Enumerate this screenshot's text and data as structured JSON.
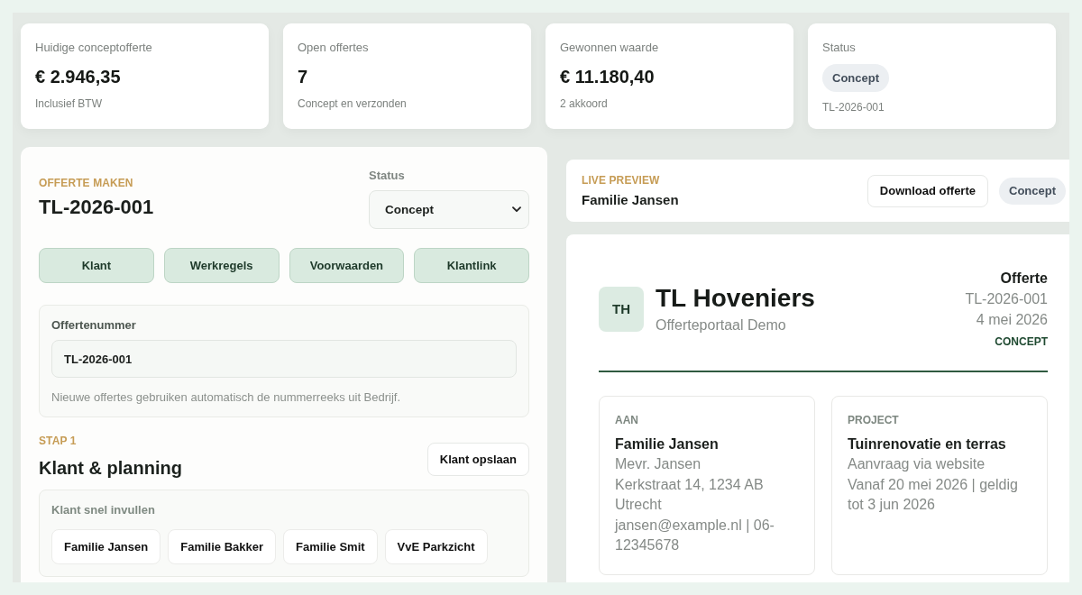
{
  "stats": [
    {
      "kind": "value",
      "label": "Huidige conceptofferte",
      "value": "€ 2.946,35",
      "note": "Inclusief BTW"
    },
    {
      "kind": "value",
      "label": "Open offertes",
      "value": "7",
      "note": "Concept en verzonden"
    },
    {
      "kind": "value",
      "label": "Gewonnen waarde",
      "value": "€ 11.180,40",
      "note": "2 akkoord"
    },
    {
      "kind": "badge",
      "label": "Status",
      "value": "Concept",
      "note": "TL-2026-001"
    }
  ],
  "editor": {
    "eyebrow": "OFFERTE MAKEN",
    "title": "TL-2026-001",
    "status_select": {
      "label": "Status",
      "value": "Concept"
    },
    "section_buttons": [
      "Klant",
      "Werkregels",
      "Voorwaarden",
      "Klantlink"
    ],
    "quote_number": {
      "label": "Offertenummer",
      "value": "TL-2026-001",
      "help": "Nieuwe offertes gebruiken automatisch de nummerreeks uit Bedrijf."
    },
    "step": {
      "eyebrow": "STAP 1",
      "title": "Klant & planning",
      "save_button": "Klant opslaan"
    },
    "quick_fill": {
      "label": "Klant snel invullen",
      "options": [
        "Familie Jansen",
        "Familie Bakker",
        "Familie Smit",
        "VvE Parkzicht"
      ]
    }
  },
  "preview_header": {
    "eyebrow": "LIVE PREVIEW",
    "title": "Familie Jansen",
    "download_button": "Download offerte",
    "status_badge": "Concept"
  },
  "document": {
    "logo_initials": "TH",
    "company": "TL Hoveniers",
    "subtitle": "Offerteportaal Demo",
    "doc_type": "Offerte",
    "number": "TL-2026-001",
    "date": "4 mei 2026",
    "status": "CONCEPT",
    "blocks": [
      {
        "heading": "AAN",
        "title": "Familie Jansen",
        "lines": [
          "Mevr. Jansen",
          "Kerkstraat 14, 1234 AB Utrecht",
          "jansen@example.nl | 06-12345678"
        ]
      },
      {
        "heading": "PROJECT",
        "title": "Tuinrenovatie en terras",
        "lines": [
          "Aanvraag via website",
          "Vanaf 20 mei 2026 | geldig tot 3 jun 2026"
        ]
      }
    ]
  }
}
